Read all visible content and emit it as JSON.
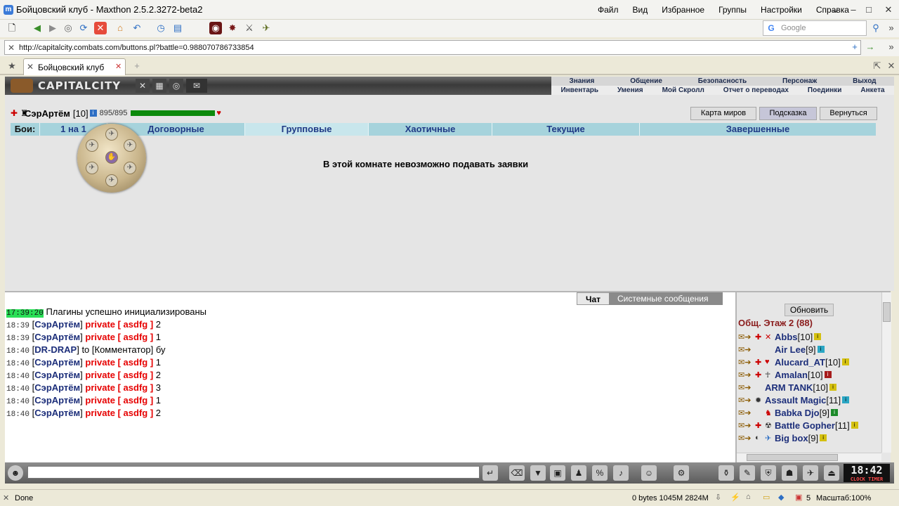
{
  "window": {
    "title": "Бойцовский клуб - Maxthon 2.5.2.3272-beta2",
    "menu": [
      "Файл",
      "Вид",
      "Избранное",
      "Группы",
      "Настройки",
      "Справка"
    ]
  },
  "toolbar": {
    "search_placeholder": "Google"
  },
  "address": {
    "url": "http://capitalcity.combats.com/buttons.pl?battle=0.988070786733854"
  },
  "tabs": [
    {
      "label": "Бойцовский клуб"
    }
  ],
  "game": {
    "logo": "CAPITALCITY",
    "menu_top": [
      "Знания",
      "Общение",
      "Безопасность",
      "Персонаж",
      "Выход"
    ],
    "menu_bottom": [
      "Инвентарь",
      "Умения",
      "Мой Скролл",
      "Отчет о переводах",
      "Поединки",
      "Анкета"
    ],
    "player": {
      "name": "СэрАртём",
      "level": "[10]",
      "hp": "895/895",
      "hp_fraction": 1.0
    },
    "buttons": {
      "world_map": "Карта миров",
      "hint": "Подсказка",
      "back": "Вернуться"
    },
    "fight_nav": {
      "label": "Бои:",
      "items": [
        "1 на 1",
        "Договорные",
        "Групповые",
        "Хаотичные",
        "Текущие",
        "Завершенные"
      ]
    },
    "message": "В этой комнате невозможно подавать заявки"
  },
  "chat": {
    "tabs": [
      "Чат",
      "Системные сообщения"
    ],
    "lines": [
      {
        "time": "17:39:20",
        "highlight": true,
        "text": "Плагины успешно инициализированы"
      },
      {
        "time": "18:39",
        "name": "СэрАртём",
        "private": "private [ asdfg ]",
        "text": "2"
      },
      {
        "time": "18:39",
        "name": "СэрАртём",
        "private": "private [ asdfg ]",
        "text": "1"
      },
      {
        "time": "18:40",
        "name": "DR-DRAP",
        "mid": "to [Комментатор]",
        "text": "бу"
      },
      {
        "time": "18:40",
        "name": "СэрАртём",
        "private": "private [ asdfg ]",
        "text": "1"
      },
      {
        "time": "18:40",
        "name": "СэрАртём",
        "private": "private [ asdfg ]",
        "text": "2"
      },
      {
        "time": "18:40",
        "name": "СэрАртём",
        "private": "private [ asdfg ]",
        "text": "3"
      },
      {
        "time": "18:40",
        "name": "СэрАртём",
        "private": "private [ asdfg ]",
        "text": "1"
      },
      {
        "time": "18:40",
        "name": "СэрАртём",
        "private": "private [ asdfg ]",
        "text": "2"
      }
    ]
  },
  "sidebar": {
    "refresh_label": "Обновить",
    "room_title": "Общ. Этаж 2 (88)",
    "users": [
      {
        "name": "Abbs",
        "level": "[10]"
      },
      {
        "name": "Air Lee",
        "level": "[9]"
      },
      {
        "name": "Alucard_AT",
        "level": "[10]"
      },
      {
        "name": "Amalan",
        "level": "[10]"
      },
      {
        "name": "ARM TANK",
        "level": "[10]"
      },
      {
        "name": "Assault Magic",
        "level": "[11]"
      },
      {
        "name": "Babka Djo",
        "level": "[9]"
      },
      {
        "name": "Battle Gopher",
        "level": "[11]"
      },
      {
        "name": "Big box",
        "level": "[9]"
      }
    ]
  },
  "clock": {
    "time": "18:42",
    "label": "CLOCK TIMER"
  },
  "status": {
    "text": "Done",
    "memory": "0 bytes 1045M 2824M",
    "tab_count": "5",
    "zoom": "Масштаб:100%"
  }
}
